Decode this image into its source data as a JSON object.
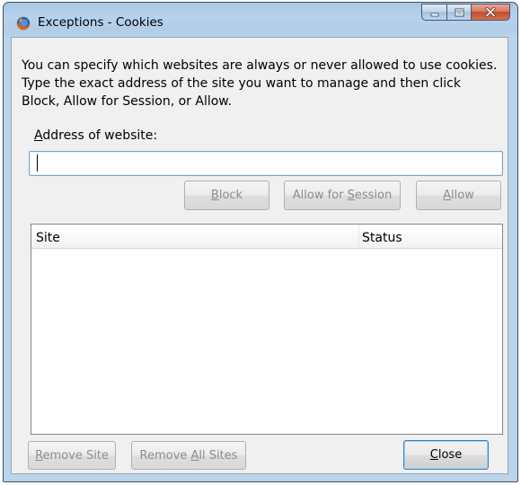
{
  "window": {
    "title": "Exceptions - Cookies"
  },
  "dialog": {
    "description": "You can specify which websites are always or never allowed to use cookies. Type the exact address of the site you want to manage and then click Block, Allow for Session, or Allow.",
    "address_label_accel": "A",
    "address_label_rest": "ddress of website:",
    "address_value": ""
  },
  "actions": {
    "block": {
      "pre": "",
      "accel": "B",
      "post": "lock"
    },
    "allow_session": {
      "pre": "Allow for ",
      "accel": "S",
      "post": "ession"
    },
    "allow": {
      "pre": "",
      "accel": "A",
      "post": "llow"
    }
  },
  "table": {
    "columns": [
      "Site",
      "Status"
    ],
    "rows": []
  },
  "footer": {
    "remove_site": {
      "pre": "",
      "accel": "R",
      "post": "emove Site"
    },
    "remove_all": {
      "pre": "Remove ",
      "accel": "A",
      "post": "ll Sites"
    },
    "close": {
      "pre": "",
      "accel": "C",
      "post": "lose"
    }
  },
  "icons": {
    "app": "firefox-icon",
    "minimize": "minimize-icon",
    "maximize": "maximize-icon",
    "close": "close-icon"
  },
  "colors": {
    "title_bar": "#b6d2ee",
    "client_bg": "#f0f0f0",
    "close_button": "#c24b2b",
    "default_button_border": "#3c7fb1",
    "disabled_text": "#8d8d8d"
  }
}
